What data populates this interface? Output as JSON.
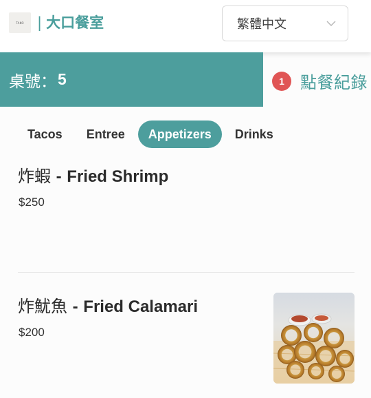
{
  "header": {
    "logo_text": "TAKO",
    "separator": "|",
    "brand_name": "大口餐室",
    "language": "繁體中文"
  },
  "table": {
    "label": "桌號：",
    "number": "5"
  },
  "orders": {
    "count": "1",
    "label": "點餐紀錄"
  },
  "tabs": [
    {
      "label": "Tacos"
    },
    {
      "label": "Entree"
    },
    {
      "label": "Appetizers"
    },
    {
      "label": "Drinks"
    }
  ],
  "active_tab": "Appetizers",
  "items": [
    {
      "name_zh": "炸蝦",
      "dash": "-",
      "name_en": "Fried Shrimp",
      "price": "$250"
    },
    {
      "name_zh": "炸魷魚",
      "dash": "-",
      "name_en": "Fried Calamari",
      "price": "$200"
    }
  ],
  "colors": {
    "accent": "#4d9e9d",
    "badge": "#e05555",
    "brand_text": "#4a9e9c"
  }
}
